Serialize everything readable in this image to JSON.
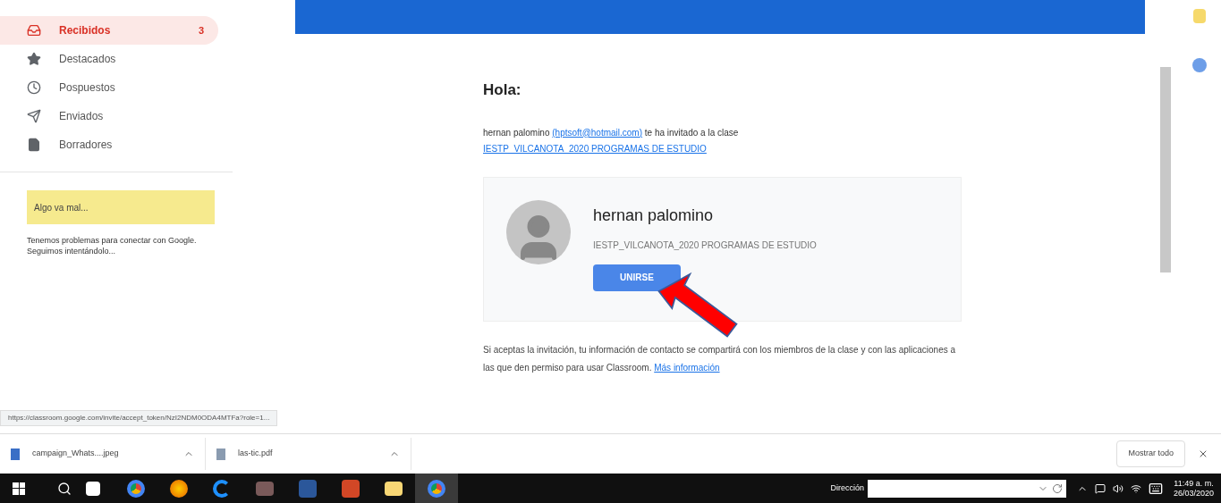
{
  "sidebar": {
    "items": [
      {
        "kind": "inbox",
        "label": "Recibidos",
        "count": "3",
        "selected": true
      },
      {
        "kind": "star",
        "label": "Destacados",
        "selected": false
      },
      {
        "kind": "clock",
        "label": "Pospuestos",
        "selected": false
      },
      {
        "kind": "send",
        "label": "Enviados",
        "selected": false
      },
      {
        "kind": "draft",
        "label": "Borradores",
        "selected": false
      }
    ],
    "warning": {
      "title": "Algo va mal...",
      "message": "Tenemos problemas para conectar con Google. Seguimos intentándolo..."
    }
  },
  "email": {
    "greeting": "Hola:",
    "invite_sender": "hernan palomino",
    "invite_email": "(hptsoft@hotmail.com)",
    "invite_text": "te ha invitado a la clase",
    "class_link": "IESTP_VILCANOTA_2020 PROGRAMAS DE ESTUDIO",
    "card": {
      "name": "hernan palomino",
      "class_name": "IESTP_VILCANOTA_2020 PROGRAMAS DE ESTUDIO",
      "button": "UNIRSE"
    },
    "notice": "Si aceptas la invitación, tu información de contacto se compartirá con los miembros de la clase y con las aplicaciones a las que den permiso para usar Classroom.",
    "notice_link": "Más información"
  },
  "status_url": "https://classroom.google.com/invite/accept_token/NzI2NDM0ODA4MTFa?role=1...",
  "downloads": {
    "items": [
      {
        "kind": "image",
        "name": "campaign_Whats....jpeg"
      },
      {
        "kind": "pdf",
        "name": "las-tic.pdf"
      }
    ],
    "show_all": "Mostrar todo"
  },
  "taskbar": {
    "apps": [
      {
        "kind": "store",
        "selected": false
      },
      {
        "kind": "chrome",
        "selected": false
      },
      {
        "kind": "firefox",
        "selected": false
      },
      {
        "kind": "edge",
        "selected": false
      },
      {
        "kind": "media",
        "selected": false
      },
      {
        "kind": "word",
        "selected": false
      },
      {
        "kind": "powerpoint",
        "selected": false
      },
      {
        "kind": "folder",
        "selected": false
      },
      {
        "kind": "chrome",
        "selected": true
      }
    ],
    "address_label": "Dirección",
    "time": "11:49 a. m.",
    "date": "26/03/2020"
  }
}
